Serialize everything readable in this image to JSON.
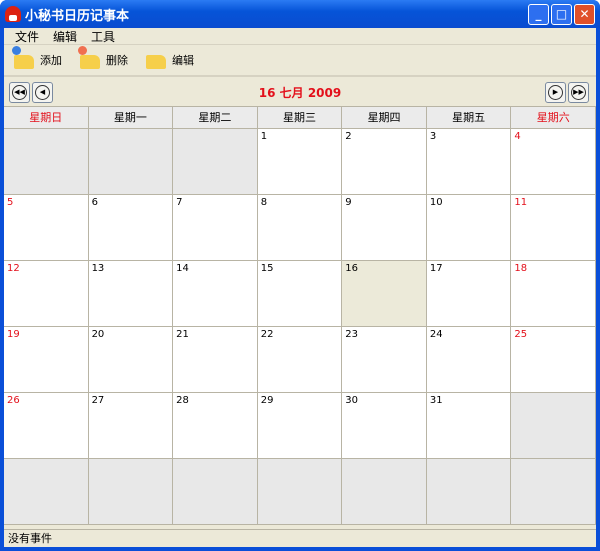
{
  "window": {
    "title": "小秘书日历记事本"
  },
  "menu": [
    "文件",
    "编辑",
    "工具"
  ],
  "toolbar": {
    "add": "添加",
    "delete": "删除",
    "edit": "编辑"
  },
  "nav": {
    "title": "16  七月  2009"
  },
  "weekdays": [
    "星期日",
    "星期一",
    "星期二",
    "星期三",
    "星期四",
    "星期五",
    "星期六"
  ],
  "days": [
    "",
    "",
    "",
    "1",
    "2",
    "3",
    "4",
    "5",
    "6",
    "7",
    "8",
    "9",
    "10",
    "11",
    "12",
    "13",
    "14",
    "15",
    "16",
    "17",
    "18",
    "19",
    "20",
    "21",
    "22",
    "23",
    "24",
    "25",
    "26",
    "27",
    "28",
    "29",
    "30",
    "31",
    "",
    "",
    "",
    "",
    "",
    "",
    "",
    ""
  ],
  "selected_day": "16",
  "status": "没有事件",
  "colors": {
    "weekend": "#e3101b",
    "selected": "#ecead9"
  }
}
